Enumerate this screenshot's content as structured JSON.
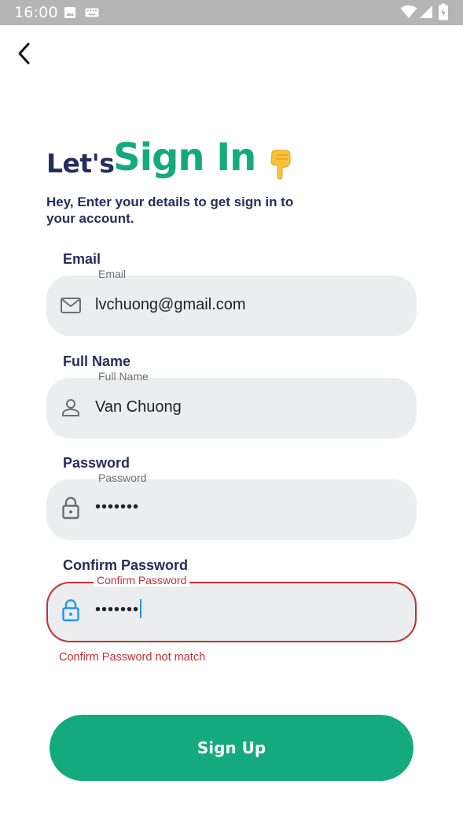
{
  "status_bar": {
    "time": "16:00"
  },
  "header": {
    "lets": "Let's",
    "sign_in": "Sign In",
    "hand_emoji": "👇",
    "subtitle": "Hey, Enter your details to get sign in to your account."
  },
  "fields": {
    "email": {
      "title": "Email",
      "label": "Email",
      "value": "lvchuong@gmail.com",
      "icon": "mail-icon"
    },
    "full_name": {
      "title": "Full Name",
      "label": "Full Name",
      "value": "Van Chuong",
      "icon": "person-icon"
    },
    "password": {
      "title": "Password",
      "label": "Password",
      "value": "•••••••",
      "icon": "lock-icon"
    },
    "confirm_password": {
      "title": "Confirm Password",
      "label": "Confirm Password",
      "value": "•••••••",
      "icon": "lock-icon",
      "error": "Confirm Password not match"
    }
  },
  "actions": {
    "sign_up": "Sign Up"
  },
  "colors": {
    "primary": "#14aa7e",
    "navy": "#252e5c",
    "error": "#c62f33",
    "field_bg": "#ebedee",
    "focus": "#2196f3"
  }
}
